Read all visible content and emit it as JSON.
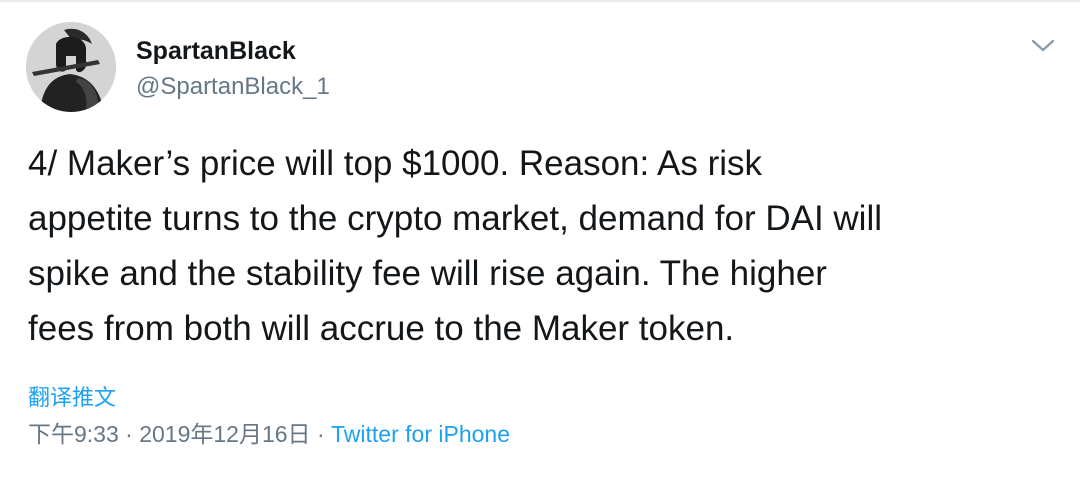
{
  "user": {
    "display_name": "SpartanBlack",
    "handle": "@SpartanBlack_1",
    "avatar_icon": "spartan-warrior-avatar"
  },
  "tweet": {
    "text": "4/ Maker’s price will top $1000. Reason: As risk\nappetite turns to the crypto market, demand for DAI will\nspike and the stability fee will rise again. The higher\nfees from both will accrue to the Maker token."
  },
  "actions": {
    "translate_label": "翻译推文",
    "caret_icon": "chevron-down-icon"
  },
  "meta": {
    "time": "下午9:33",
    "separator_1": " · ",
    "date": "2019年12月16日",
    "separator_2": " · ",
    "source": "Twitter for iPhone"
  },
  "colors": {
    "link": "#1da1f2",
    "secondary_text": "#657786",
    "primary_text": "#14171a"
  }
}
